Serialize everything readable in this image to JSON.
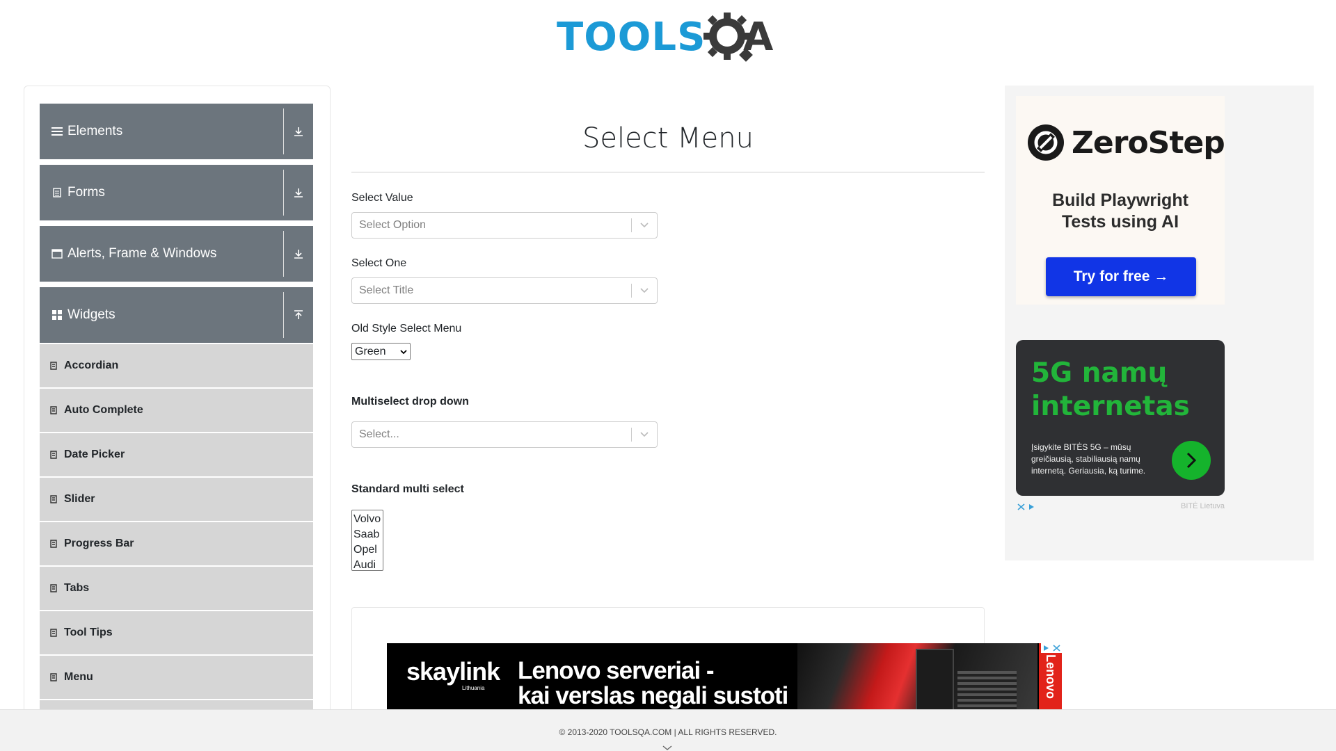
{
  "header": {
    "logo_text_left": "TOOLS",
    "logo_text_right": "QA"
  },
  "sidebar": {
    "groups": [
      {
        "label": "Elements",
        "icon": "hamburger-icon",
        "state": "collapsed"
      },
      {
        "label": "Forms",
        "icon": "document-icon",
        "state": "collapsed"
      },
      {
        "label": "Alerts, Frame & Windows",
        "icon": "window-icon",
        "state": "collapsed"
      },
      {
        "label": "Widgets",
        "icon": "grid-icon",
        "state": "expanded"
      }
    ],
    "items": [
      {
        "label": "Accordian"
      },
      {
        "label": "Auto Complete"
      },
      {
        "label": "Date Picker"
      },
      {
        "label": "Slider"
      },
      {
        "label": "Progress Bar"
      },
      {
        "label": "Tabs"
      },
      {
        "label": "Tool Tips"
      },
      {
        "label": "Menu"
      }
    ]
  },
  "main": {
    "title": "Select Menu",
    "select_value": {
      "label": "Select Value",
      "placeholder": "Select Option"
    },
    "select_one": {
      "label": "Select One",
      "placeholder": "Select Title"
    },
    "old_style": {
      "label": "Old Style Select Menu",
      "selected": "Green"
    },
    "multiselect": {
      "label": "Multiselect drop down",
      "placeholder": "Select..."
    },
    "standard_multi": {
      "label": "Standard multi select",
      "options": [
        "Volvo",
        "Saab",
        "Opel",
        "Audi"
      ]
    }
  },
  "banner_ad": {
    "brand": "skaylink",
    "brand_sub": "Lithuania",
    "headline_line1": "Lenovo serveriai -",
    "headline_line2": "kai verslas negali sustoti",
    "side_brand": "Lenovo"
  },
  "right_ad": {
    "zerostep_name": "ZeroStep",
    "zerostep_tagline_1": "Build Playwright",
    "zerostep_tagline_2": "Tests using AI",
    "zerostep_button": "Try for free →",
    "bite_headline_1": "5G namų",
    "bite_headline_2": "internetas",
    "bite_text": "Įsigykite BITĖS 5G – mūsų greičiausią, stabiliausią namų internetą. Geriausia, ką turime.",
    "bite_brand": "BITĖ Lietuva"
  },
  "footer": {
    "copyright": "© 2013-2020 TOOLSQA.COM | ALL RIGHTS RESERVED."
  },
  "colors": {
    "header_blue": "#1c9ad6",
    "group_bg": "#6c757d",
    "item_bg": "#d6d6d6",
    "zerostep_blue": "#1135e6",
    "bite_green": "#22b53a"
  }
}
